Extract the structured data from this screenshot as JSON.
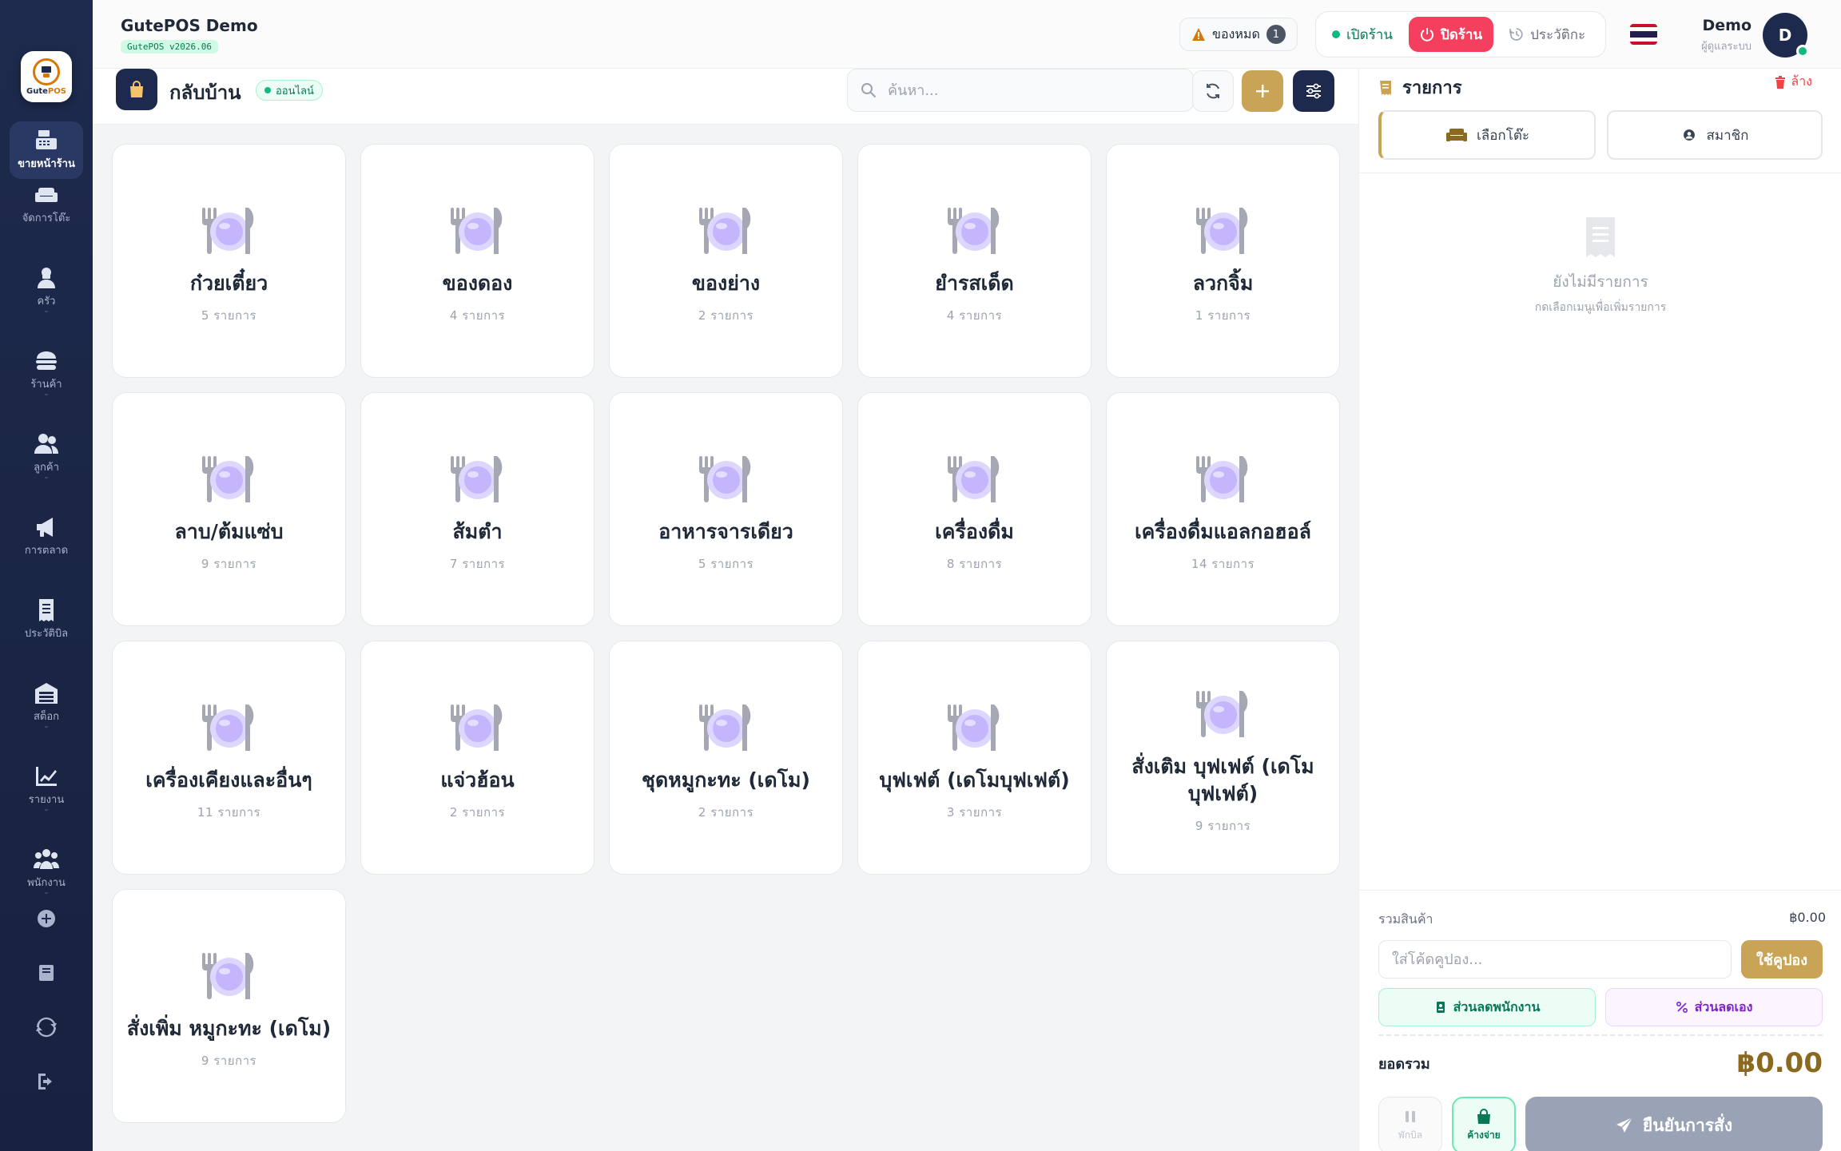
{
  "colors": {
    "navy": "#1e2a4d",
    "gold": "#c9a456",
    "green": "#10b981",
    "red": "#f43f5e",
    "dish_purple": "#c4b5fd"
  },
  "sidebar": {
    "logo_text": "Gute",
    "logo_text_accent": "POS",
    "items": [
      {
        "label": "ขายหน้าร้าน",
        "icon": "cash-register-icon",
        "active": true
      },
      {
        "label": "จัดการโต๊ะ",
        "icon": "sofa-icon"
      },
      {
        "label": "ครัว",
        "icon": "chef-icon"
      },
      {
        "label": "ร้านค้า",
        "icon": "burger-icon"
      },
      {
        "label": "ลูกค้า",
        "icon": "users-icon"
      },
      {
        "label": "การตลาด",
        "icon": "megaphone-icon"
      },
      {
        "label": "ประวัติบิล",
        "icon": "receipt-icon"
      },
      {
        "label": "สต็อก",
        "icon": "warehouse-icon"
      },
      {
        "label": "รายงาน",
        "icon": "chart-icon"
      },
      {
        "label": "พนักงาน",
        "icon": "staff-icon"
      }
    ],
    "bottom_icons": [
      "plus-circle-icon",
      "book-icon",
      "sync-icon",
      "logout-icon"
    ]
  },
  "header": {
    "brand_name": "GutePOS Demo",
    "version": "GutePOS v2026.06",
    "out_of_stock_label": "ของหมด",
    "out_of_stock_count": "1",
    "open_store_label": "เปิดร้าน",
    "close_store_label": "ปิดร้าน",
    "history_label": "ประวัติกะ",
    "user_name": "Demo",
    "user_role": "ผู้ดูแลระบบ",
    "avatar_initial": "D"
  },
  "toolbar": {
    "mode_title": "กลับบ้าน",
    "status": "ออนไลน์",
    "search_placeholder": "ค้นหา..."
  },
  "categories": [
    {
      "name": "ก๋วยเตี๋ยว",
      "count": "5 รายการ"
    },
    {
      "name": "ของดอง",
      "count": "4 รายการ"
    },
    {
      "name": "ของย่าง",
      "count": "2 รายการ"
    },
    {
      "name": "ยำรสเด็ด",
      "count": "4 รายการ"
    },
    {
      "name": "ลวกจิ้ม",
      "count": "1 รายการ"
    },
    {
      "name": "ลาบ/ต้มแซ่บ",
      "count": "9 รายการ"
    },
    {
      "name": "ส้มตำ",
      "count": "7 รายการ"
    },
    {
      "name": "อาหารจารเดียว",
      "count": "5 รายการ"
    },
    {
      "name": "เครื่องดื่ม",
      "count": "8 รายการ"
    },
    {
      "name": "เครื่องดื่มแอลกอฮอล์",
      "count": "14 รายการ"
    },
    {
      "name": "เครื่องเคียงและอื่นๆ",
      "count": "11 รายการ"
    },
    {
      "name": "แจ่วฮ้อน",
      "count": "2 รายการ"
    },
    {
      "name": "ชุดหมูกะทะ (เดโม)",
      "count": "2 รายการ"
    },
    {
      "name": "บุฟเฟต์ (เดโมบุฟเฟต์)",
      "count": "3 รายการ"
    },
    {
      "name": "สั่งเติม บุฟเฟต์ (เดโม บุฟเฟต์)",
      "count": "9 รายการ"
    },
    {
      "name": "สั่งเพิ่ม หมูกะทะ (เดโม)",
      "count": "9 รายการ"
    }
  ],
  "order": {
    "title": "รายการ",
    "clear_label": "ล้าง",
    "select_table_label": "เลือกโต๊ะ",
    "member_label": "สมาชิก",
    "empty_title": "ยังไม่มีรายการ",
    "empty_hint": "กดเลือกเมนูเพื่อเพิ่มรายการ",
    "subtotal_label": "รวมสินค้า",
    "subtotal_value": "฿0.00",
    "coupon_placeholder": "ใส่โค้ดคูปอง...",
    "coupon_button": "ใช้คูปอง",
    "staff_discount_label": "ส่วนลดพนักงาน",
    "custom_discount_label": "ส่วนลดเอง",
    "total_label": "ยอดรวม",
    "total_value": "฿0.00",
    "hold_label": "พักบิล",
    "pending_label": "ค้างจ่าย",
    "confirm_label": "ยืนยันการสั่ง"
  }
}
